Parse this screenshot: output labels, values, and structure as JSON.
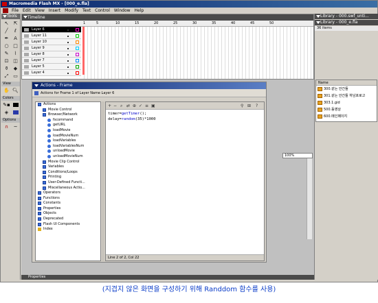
{
  "window": {
    "title": "Macromedia Flash MX - [000_e.fla]"
  },
  "menubar": [
    "File",
    "Edit",
    "View",
    "Insert",
    "Modify",
    "Text",
    "Control",
    "Window",
    "Help"
  ],
  "tools": {
    "header": "Tools",
    "sections": [
      "View",
      "Colors",
      "Options"
    ]
  },
  "timeline": {
    "header": "Timeline",
    "ruler": [
      "1",
      "5",
      "10",
      "15",
      "20",
      "25",
      "30",
      "35",
      "40",
      "45",
      "50"
    ],
    "layers": [
      "Layer 6",
      "Layer 11",
      "Layer 10",
      "Layer 9",
      "Layer 8",
      "Layer 7",
      "Layer 5",
      "Layer 4"
    ]
  },
  "library": {
    "header1": "Library - 000.swf_unti...",
    "header2": "Library - 000_e.fla",
    "count": "36 items",
    "column": "Name",
    "items": [
      "300.같는 안간들",
      "301.같는 안간들 하남포로고",
      "303.1.gid",
      "500.동영상",
      "600.메인페이지"
    ]
  },
  "actions": {
    "title": "Actions - Frame",
    "bar": "Actions for Frame 1 of Layer Name Layer 6",
    "tree": [
      {
        "label": "Actions",
        "lvl": 0,
        "k": "bk"
      },
      {
        "label": "Movie Control",
        "lvl": 1,
        "k": "bk"
      },
      {
        "label": "Browser/Network",
        "lvl": 1,
        "k": "bk"
      },
      {
        "label": "fscommand",
        "lvl": 2,
        "k": "ci"
      },
      {
        "label": "getURL",
        "lvl": 2,
        "k": "ci"
      },
      {
        "label": "loadMovie",
        "lvl": 2,
        "k": "ci"
      },
      {
        "label": "loadMovieNum",
        "lvl": 2,
        "k": "ci"
      },
      {
        "label": "loadVariables",
        "lvl": 2,
        "k": "ci"
      },
      {
        "label": "loadVariablesNum",
        "lvl": 2,
        "k": "ci"
      },
      {
        "label": "unloadMovie",
        "lvl": 2,
        "k": "ci"
      },
      {
        "label": "unloadMovieNum",
        "lvl": 2,
        "k": "ci"
      },
      {
        "label": "Movie Clip Control",
        "lvl": 1,
        "k": "bk"
      },
      {
        "label": "Variables",
        "lvl": 1,
        "k": "bk"
      },
      {
        "label": "Conditions/Loops",
        "lvl": 1,
        "k": "bk"
      },
      {
        "label": "Printing",
        "lvl": 1,
        "k": "bk"
      },
      {
        "label": "User-Defined Functi...",
        "lvl": 1,
        "k": "bk"
      },
      {
        "label": "Miscellaneous Actio...",
        "lvl": 1,
        "k": "bk"
      },
      {
        "label": "Operators",
        "lvl": 0,
        "k": "bk"
      },
      {
        "label": "Functions",
        "lvl": 0,
        "k": "bk"
      },
      {
        "label": "Constants",
        "lvl": 0,
        "k": "bk"
      },
      {
        "label": "Properties",
        "lvl": 0,
        "k": "bk"
      },
      {
        "label": "Objects",
        "lvl": 0,
        "k": "bk"
      },
      {
        "label": "Deprecated",
        "lvl": 0,
        "k": "bk"
      },
      {
        "label": "Flash UI Components",
        "lvl": 0,
        "k": "bk"
      },
      {
        "label": "Index",
        "lvl": 0,
        "k": "ix"
      }
    ],
    "code_line1_var": "timer=",
    "code_line1_fn": "getTimer",
    "code_line1_end": "();",
    "code_line2_var": "delay=",
    "code_line2_fn": "random",
    "code_line2_end": "(35)*1000",
    "status": "Line 2 of 2, Col 22"
  },
  "zoom": "100%",
  "properties": "Properties",
  "caption": "(지겹지 않은 화면을 구성하기 위해 Randdom 함수를 사용)"
}
